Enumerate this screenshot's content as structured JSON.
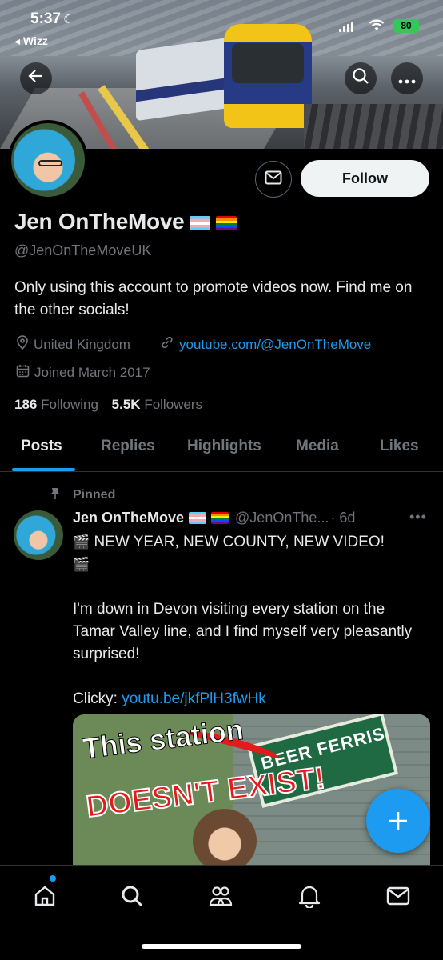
{
  "status_bar": {
    "time": "5:37",
    "back_app": "◂ Wizz",
    "battery": "80"
  },
  "header": {
    "back_icon": "arrow-left-icon",
    "search_icon": "search-icon",
    "more_icon": "more-horizontal-icon"
  },
  "profile": {
    "display_name": "Jen OnTheMove",
    "handle": "@JenOnTheMoveUK",
    "bio": "Only using this account to promote videos now. Find me on the other socials!",
    "location": "United Kingdom",
    "website": "youtube.com/@JenOnTheMove",
    "joined": "Joined March 2017",
    "following_count": "186",
    "following_label": "Following",
    "followers_count": "5.5K",
    "followers_label": "Followers",
    "follow_button": "Follow"
  },
  "tabs": [
    {
      "label": "Posts",
      "active": true
    },
    {
      "label": "Replies",
      "active": false
    },
    {
      "label": "Highlights",
      "active": false
    },
    {
      "label": "Media",
      "active": false
    },
    {
      "label": "Likes",
      "active": false
    }
  ],
  "post": {
    "pinned_label": "Pinned",
    "author_name": "Jen OnTheMove",
    "author_handle": "@JenOnThe...",
    "time": "· 6d",
    "line1": " NEW YEAR, NEW COUNTY, NEW VIDEO!",
    "line2": "I'm down in Devon visiting every station on the Tamar Valley line, and I find myself very pleasantly surprised!",
    "clicky_label": "Clicky: ",
    "link": "youtu.be/jkfPlH3fwHk",
    "thumbnail": {
      "caption_white": "This station",
      "caption_red": "DOESN'T EXIST!",
      "sign_text": "BEER FERRIS"
    }
  },
  "bottom_nav": [
    "home-icon",
    "search-icon",
    "communities-icon",
    "notifications-icon",
    "messages-icon"
  ],
  "colors": {
    "accent": "#1d9bf0",
    "background": "#000000",
    "text_primary": "#e7e9ea",
    "text_secondary": "#71767b"
  }
}
